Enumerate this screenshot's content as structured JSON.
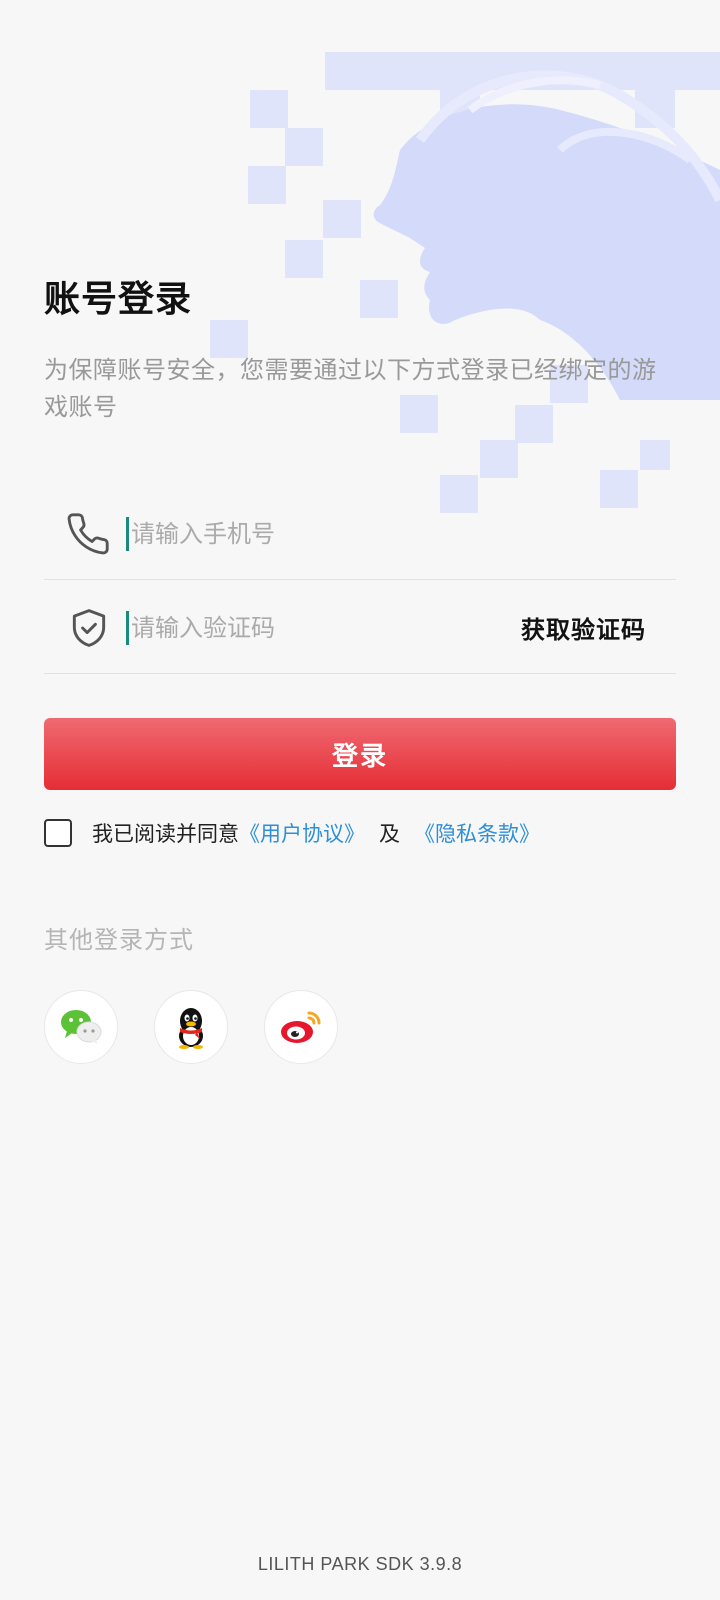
{
  "header": {
    "title": "账号登录",
    "subtitle": "为保障账号安全，您需要通过以下方式登录已经绑定的游戏账号"
  },
  "phone_field": {
    "icon": "phone-icon",
    "placeholder": "请输入手机号",
    "value": ""
  },
  "code_field": {
    "icon": "shield-check-icon",
    "placeholder": "请输入验证码",
    "value": "",
    "get_code_label": "获取验证码"
  },
  "login_button": {
    "label": "登录"
  },
  "agreement": {
    "checked": false,
    "prefix": "我已阅读并同意",
    "user_agreement": "《用户协议》",
    "conjunction": "及",
    "privacy_policy": "《隐私条款》"
  },
  "other_login": {
    "label": "其他登录方式",
    "providers": [
      "wechat-icon",
      "qq-icon",
      "weibo-icon"
    ]
  },
  "footer": {
    "version": "LILITH PARK SDK 3.9.8"
  },
  "colors": {
    "accent": "#e62d35",
    "link": "#2d8fd8",
    "caret": "#1a8a7a",
    "background": "#f7f7f7"
  }
}
